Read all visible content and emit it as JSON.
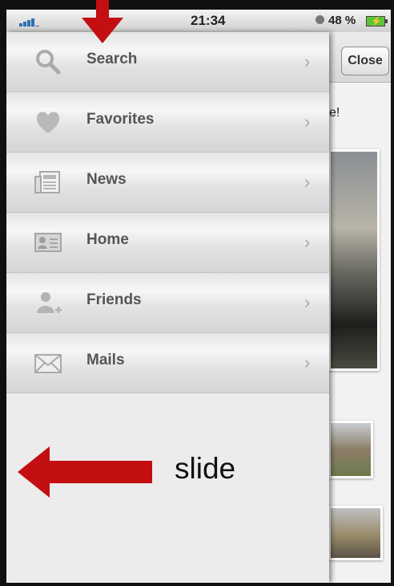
{
  "status_bar": {
    "time": "21:34",
    "battery_text": "48 %",
    "battery_color": "#5ec23a"
  },
  "background_app": {
    "close_label": "Close",
    "partial_text": "e!"
  },
  "menu": {
    "items": [
      {
        "label": "Search",
        "icon": "search-icon"
      },
      {
        "label": "Favorites",
        "icon": "heart-icon"
      },
      {
        "label": "News",
        "icon": "newspaper-icon"
      },
      {
        "label": "Home",
        "icon": "contact-card-icon"
      },
      {
        "label": "Friends",
        "icon": "add-person-icon"
      },
      {
        "label": "Mails",
        "icon": "envelope-icon"
      }
    ],
    "chevron": "›"
  },
  "annotation": {
    "slide_label": "slide",
    "arrow_color": "#c40f12"
  }
}
